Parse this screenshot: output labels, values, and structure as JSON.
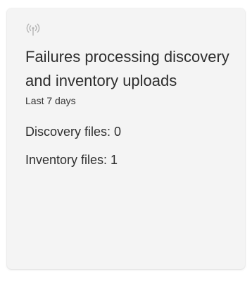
{
  "card": {
    "icon": "antenna-signal-icon",
    "title": "Failures processing discovery and inventory uploads",
    "period": "Last 7 days",
    "stats": {
      "discovery": "Discovery files: 0",
      "inventory": "Inventory files: 1"
    }
  },
  "colors": {
    "card_background": "#f4f4f4",
    "icon": "#b5b5b5",
    "text": "#2e2e2e"
  }
}
